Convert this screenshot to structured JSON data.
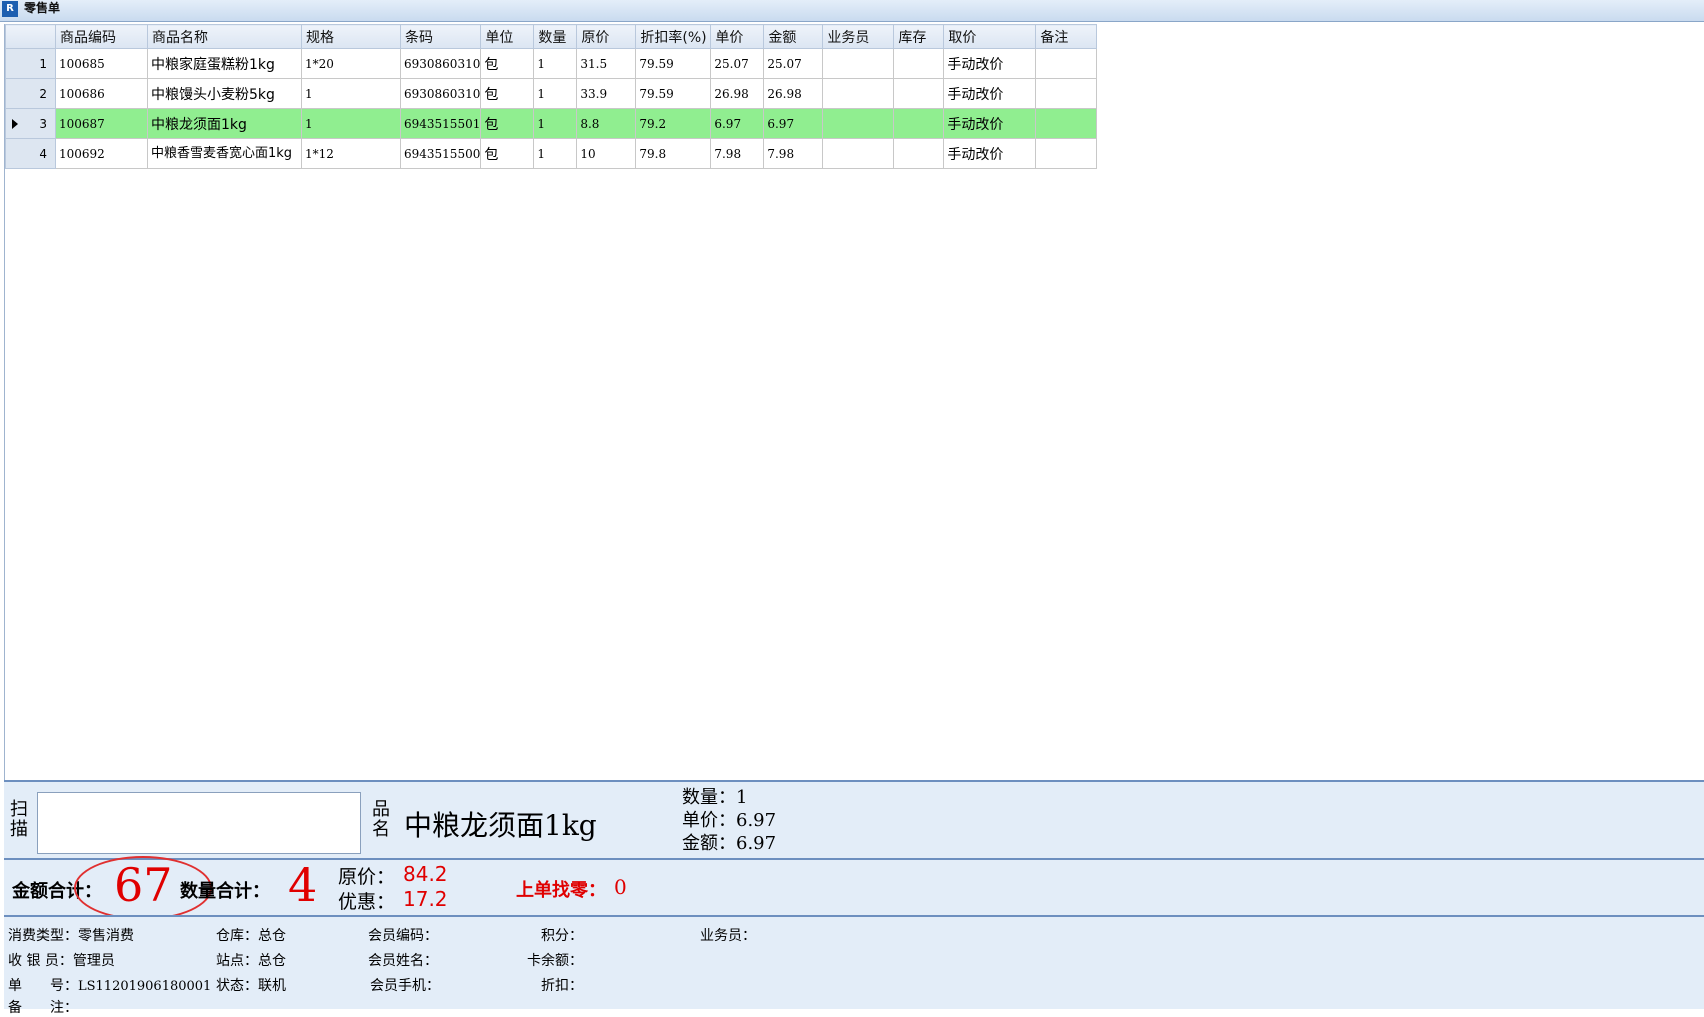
{
  "window": {
    "title": "零售单",
    "icon": "app-icon"
  },
  "grid": {
    "columns": [
      "商品编码",
      "商品名称",
      "规格",
      "条码",
      "单位",
      "数量",
      "原价",
      "折扣率(%)",
      "单价",
      "金额",
      "业务员",
      "库存",
      "取价",
      "备注"
    ],
    "rows": [
      {
        "num": "1",
        "code": "100685",
        "name": "中粮家庭蛋糕粉1kg",
        "spec": "1*20",
        "barcode": "6930860310",
        "unit": "包",
        "qty": "1",
        "orig": "31.5",
        "disc": "79.59",
        "price": "25.07",
        "amount": "25.07",
        "clerk": "",
        "stock": "",
        "pricing": "手动改价",
        "note": ""
      },
      {
        "num": "2",
        "code": "100686",
        "name": "中粮馒头小麦粉5kg",
        "spec": "1",
        "barcode": "6930860310",
        "unit": "包",
        "qty": "1",
        "orig": "33.9",
        "disc": "79.59",
        "price": "26.98",
        "amount": "26.98",
        "clerk": "",
        "stock": "",
        "pricing": "手动改价",
        "note": ""
      },
      {
        "num": "3",
        "code": "100687",
        "name": "中粮龙须面1kg",
        "spec": "1",
        "barcode": "6943515501",
        "unit": "包",
        "qty": "1",
        "orig": "8.8",
        "disc": "79.2",
        "price": "6.97",
        "amount": "6.97",
        "clerk": "",
        "stock": "",
        "pricing": "手动改价",
        "note": ""
      },
      {
        "num": "4",
        "code": "100692",
        "name": "中粮香雪麦香宽心面1kg",
        "spec": "1*12",
        "barcode": "6943515500",
        "unit": "包",
        "qty": "1",
        "orig": "10",
        "disc": "79.8",
        "price": "7.98",
        "amount": "7.98",
        "clerk": "",
        "stock": "",
        "pricing": "手动改价",
        "note": ""
      }
    ],
    "selected_row": 3,
    "selected_color": "#90ee90"
  },
  "scan": {
    "label": "扫描",
    "input_value": "",
    "product_label": "品名",
    "product_name": "中粮龙须面1kg",
    "qty_line": "数量：1",
    "price_line": "单价：6.97",
    "amount_line": "金额：6.97"
  },
  "totals": {
    "amount_label": "金额合计：",
    "amount_value": "67",
    "qty_label": "数量合计：",
    "qty_value": "4",
    "orig_label": "原价：",
    "orig_value": "84.2",
    "discount_label": "优惠：",
    "discount_value": "17.2",
    "change_label": "上单找零：",
    "change_value": "0",
    "highlight_color": "#e00000"
  },
  "footer": {
    "consume_type_label": "消费类型：",
    "consume_type_value": "零售消费",
    "cashier_label": "收 银 员：",
    "cashier_value": "管理员",
    "order_no_label": "单　　号：",
    "order_no_value": "LS11201906180001",
    "remark_label": "备　　注：",
    "warehouse_label": "仓库：",
    "warehouse_value": "总仓",
    "station_label": "站点：",
    "station_value": "总仓",
    "status_label": "状态：",
    "status_value": "联机",
    "member_code_label": "会员编码：",
    "member_name_label": "会员姓名：",
    "member_phone_label": "会员手机：",
    "points_label": "积分：",
    "card_balance_label": "卡余额：",
    "discount_label": "折扣：",
    "clerk_label": "业务员："
  }
}
